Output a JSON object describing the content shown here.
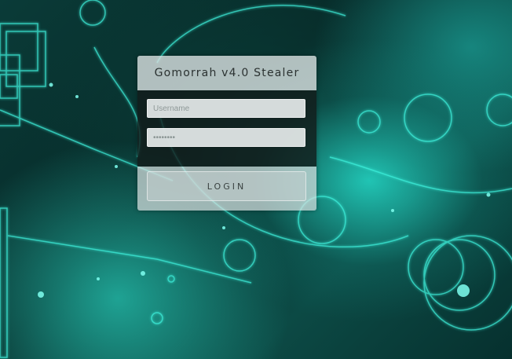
{
  "login": {
    "title": "Gomorrah v4.0 Stealer",
    "username_placeholder": "Username",
    "password_value": "********",
    "button_label": "LOGIN"
  },
  "colors": {
    "accent": "#2ef0dc",
    "background": "#062a28"
  },
  "icons": []
}
